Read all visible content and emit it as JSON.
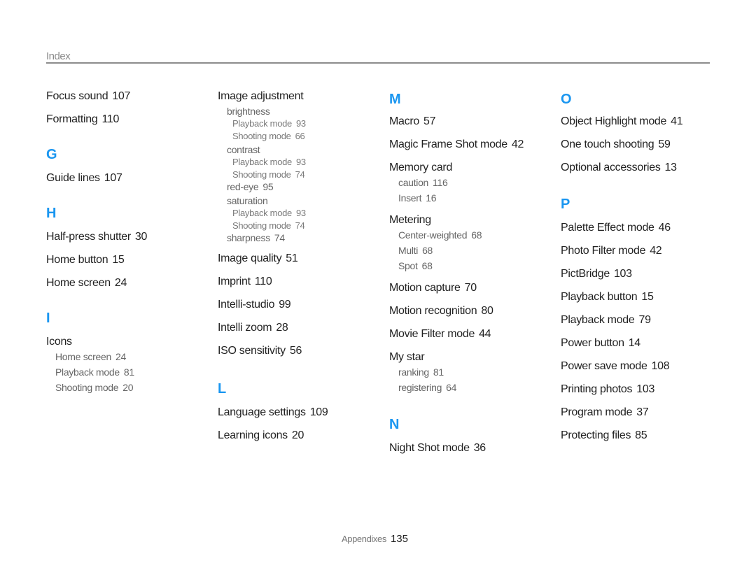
{
  "header": {
    "title": "Index"
  },
  "colors": {
    "accent": "#1a96f0",
    "text": "#222222",
    "subtext": "#666666",
    "rule": "#8c8c8c"
  },
  "columns": [
    {
      "sections": [
        {
          "letter": "",
          "entries": [
            {
              "term": "Focus sound",
              "page": "107"
            },
            {
              "term": "Formatting",
              "page": "110"
            }
          ]
        },
        {
          "letter": "G",
          "entries": [
            {
              "term": "Guide lines",
              "page": "107"
            }
          ]
        },
        {
          "letter": "H",
          "entries": [
            {
              "term": "Half-press shutter",
              "page": "30"
            },
            {
              "term": "Home button",
              "page": "15"
            },
            {
              "term": "Home screen",
              "page": "24"
            }
          ]
        },
        {
          "letter": "I",
          "entries": [
            {
              "term": "Icons",
              "page": "",
              "subs": [
                {
                  "term": "Home screen",
                  "page": "24"
                },
                {
                  "term": "Playback mode",
                  "page": "81"
                },
                {
                  "term": "Shooting mode",
                  "page": "20"
                }
              ]
            }
          ]
        }
      ]
    },
    {
      "sections": [
        {
          "letter": "",
          "entries": [
            {
              "term": "Image adjustment",
              "page": "",
              "subs": [
                {
                  "term": "brightness",
                  "page": "",
                  "subs": [
                    {
                      "term": "Playback mode",
                      "page": "93"
                    },
                    {
                      "term": "Shooting mode",
                      "page": "66"
                    }
                  ]
                },
                {
                  "term": "contrast",
                  "page": "",
                  "subs": [
                    {
                      "term": "Playback mode",
                      "page": "93"
                    },
                    {
                      "term": "Shooting mode",
                      "page": "74"
                    }
                  ]
                },
                {
                  "term": "red-eye",
                  "page": "95"
                },
                {
                  "term": "saturation",
                  "page": "",
                  "subs": [
                    {
                      "term": "Playback mode",
                      "page": "93"
                    },
                    {
                      "term": "Shooting mode",
                      "page": "74"
                    }
                  ]
                },
                {
                  "term": "sharpness",
                  "page": "74"
                }
              ]
            },
            {
              "term": "Image quality",
              "page": "51"
            },
            {
              "term": "Imprint",
              "page": "110"
            },
            {
              "term": "Intelli-studio",
              "page": "99"
            },
            {
              "term": "Intelli zoom",
              "page": "28"
            },
            {
              "term": "ISO sensitivity",
              "page": "56"
            }
          ]
        },
        {
          "letter": "L",
          "entries": [
            {
              "term": "Language settings",
              "page": "109"
            },
            {
              "term": "Learning icons",
              "page": "20"
            }
          ]
        }
      ]
    },
    {
      "sections": [
        {
          "letter": "M",
          "entries": [
            {
              "term": "Macro",
              "page": "57"
            },
            {
              "term": "Magic Frame Shot mode",
              "page": "42"
            },
            {
              "term": "Memory card",
              "page": "",
              "subs": [
                {
                  "term": "caution",
                  "page": "116"
                },
                {
                  "term": "Insert",
                  "page": "16"
                }
              ]
            },
            {
              "term": "Metering",
              "page": "",
              "subs": [
                {
                  "term": "Center-weighted",
                  "page": "68"
                },
                {
                  "term": "Multi",
                  "page": "68"
                },
                {
                  "term": "Spot",
                  "page": "68"
                }
              ]
            },
            {
              "term": "Motion capture",
              "page": "70"
            },
            {
              "term": "Motion recognition",
              "page": "80"
            },
            {
              "term": "Movie Filter mode",
              "page": "44"
            },
            {
              "term": "My star",
              "page": "",
              "subs": [
                {
                  "term": "ranking",
                  "page": "81"
                },
                {
                  "term": "registering",
                  "page": "64"
                }
              ]
            }
          ]
        },
        {
          "letter": "N",
          "entries": [
            {
              "term": "Night Shot mode",
              "page": "36"
            }
          ]
        }
      ]
    },
    {
      "sections": [
        {
          "letter": "O",
          "entries": [
            {
              "term": "Object Highlight mode",
              "page": "41"
            },
            {
              "term": "One touch shooting",
              "page": "59"
            },
            {
              "term": "Optional accessories",
              "page": "13"
            }
          ]
        },
        {
          "letter": "P",
          "entries": [
            {
              "term": "Palette Effect mode",
              "page": "46"
            },
            {
              "term": "Photo Filter mode",
              "page": "42"
            },
            {
              "term": "PictBridge",
              "page": "103"
            },
            {
              "term": "Playback button",
              "page": "15"
            },
            {
              "term": "Playback mode",
              "page": "79"
            },
            {
              "term": "Power button",
              "page": "14"
            },
            {
              "term": "Power save mode",
              "page": "108"
            },
            {
              "term": "Printing photos",
              "page": "103"
            },
            {
              "term": "Program mode",
              "page": "37"
            },
            {
              "term": "Protecting files",
              "page": "85"
            }
          ]
        }
      ]
    }
  ],
  "footer": {
    "section": "Appendixes",
    "page_number": "135"
  }
}
